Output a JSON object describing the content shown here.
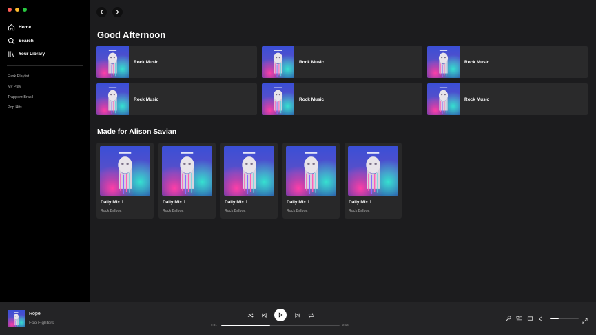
{
  "window": {
    "dot_colors": [
      "#ff5f57",
      "#febc2e",
      "#28c840"
    ]
  },
  "sidebar": {
    "nav": [
      {
        "label": "Home",
        "icon": "home-icon"
      },
      {
        "label": "Search",
        "icon": "search-icon"
      },
      {
        "label": "Your Library",
        "icon": "library-icon"
      }
    ],
    "playlists": [
      "Funk Playlist",
      "My Play",
      "Trapperz Brasil",
      "Pop Hits"
    ]
  },
  "main": {
    "greeting": "Good Afternoon",
    "quick_picks": [
      "Rock Music",
      "Rock Music",
      "Rock Music",
      "Rock Music",
      "Rock Music",
      "Rock Music"
    ],
    "made_for_heading": "Made for Alison Savian",
    "mixes": [
      {
        "title": "Daily Mix 1",
        "artist": "Rock Balboa"
      },
      {
        "title": "Daily Mix 1",
        "artist": "Rock Balboa"
      },
      {
        "title": "Daily Mix 1",
        "artist": "Rock Balboa"
      },
      {
        "title": "Daily Mix 1",
        "artist": "Rock Balboa"
      },
      {
        "title": "Daily Mix 1",
        "artist": "Rock Balboa"
      }
    ]
  },
  "player": {
    "song": "Rope",
    "artist": "Foo Fighters",
    "current_time": "0:31",
    "total_time": "2:14",
    "progress_fraction": 0.41,
    "volume_fraction": 0.3
  },
  "colors": {
    "accent": "#ffffff",
    "sidebar_bg": "#000000",
    "main_bg": "#1c1c1e",
    "card_bg": "#2a2a2b"
  }
}
